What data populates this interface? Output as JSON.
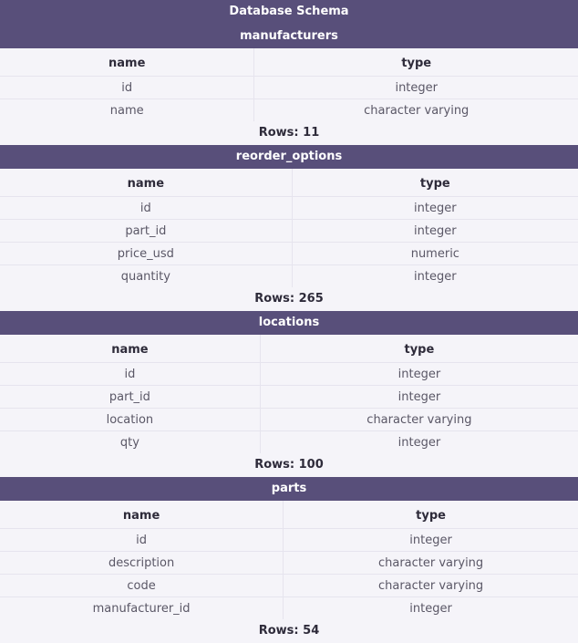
{
  "title": "Database Schema",
  "tables": [
    {
      "name": "manufacturers",
      "headers": [
        "name",
        "type"
      ],
      "rows": [
        [
          "id",
          "integer"
        ],
        [
          "name",
          "character varying"
        ]
      ],
      "rows_label": "Rows: 11"
    },
    {
      "name": "reorder_options",
      "headers": [
        "name",
        "type"
      ],
      "rows": [
        [
          "id",
          "integer"
        ],
        [
          "part_id",
          "integer"
        ],
        [
          "price_usd",
          "numeric"
        ],
        [
          "quantity",
          "integer"
        ]
      ],
      "rows_label": "Rows: 265"
    },
    {
      "name": "locations",
      "headers": [
        "name",
        "type"
      ],
      "rows": [
        [
          "id",
          "integer"
        ],
        [
          "part_id",
          "integer"
        ],
        [
          "location",
          "character varying"
        ],
        [
          "qty",
          "integer"
        ]
      ],
      "rows_label": "Rows: 100"
    },
    {
      "name": "parts",
      "headers": [
        "name",
        "type"
      ],
      "rows": [
        [
          "id",
          "integer"
        ],
        [
          "description",
          "character varying"
        ],
        [
          "code",
          "character varying"
        ],
        [
          "manufacturer_id",
          "integer"
        ]
      ],
      "rows_label": "Rows: 54"
    }
  ]
}
